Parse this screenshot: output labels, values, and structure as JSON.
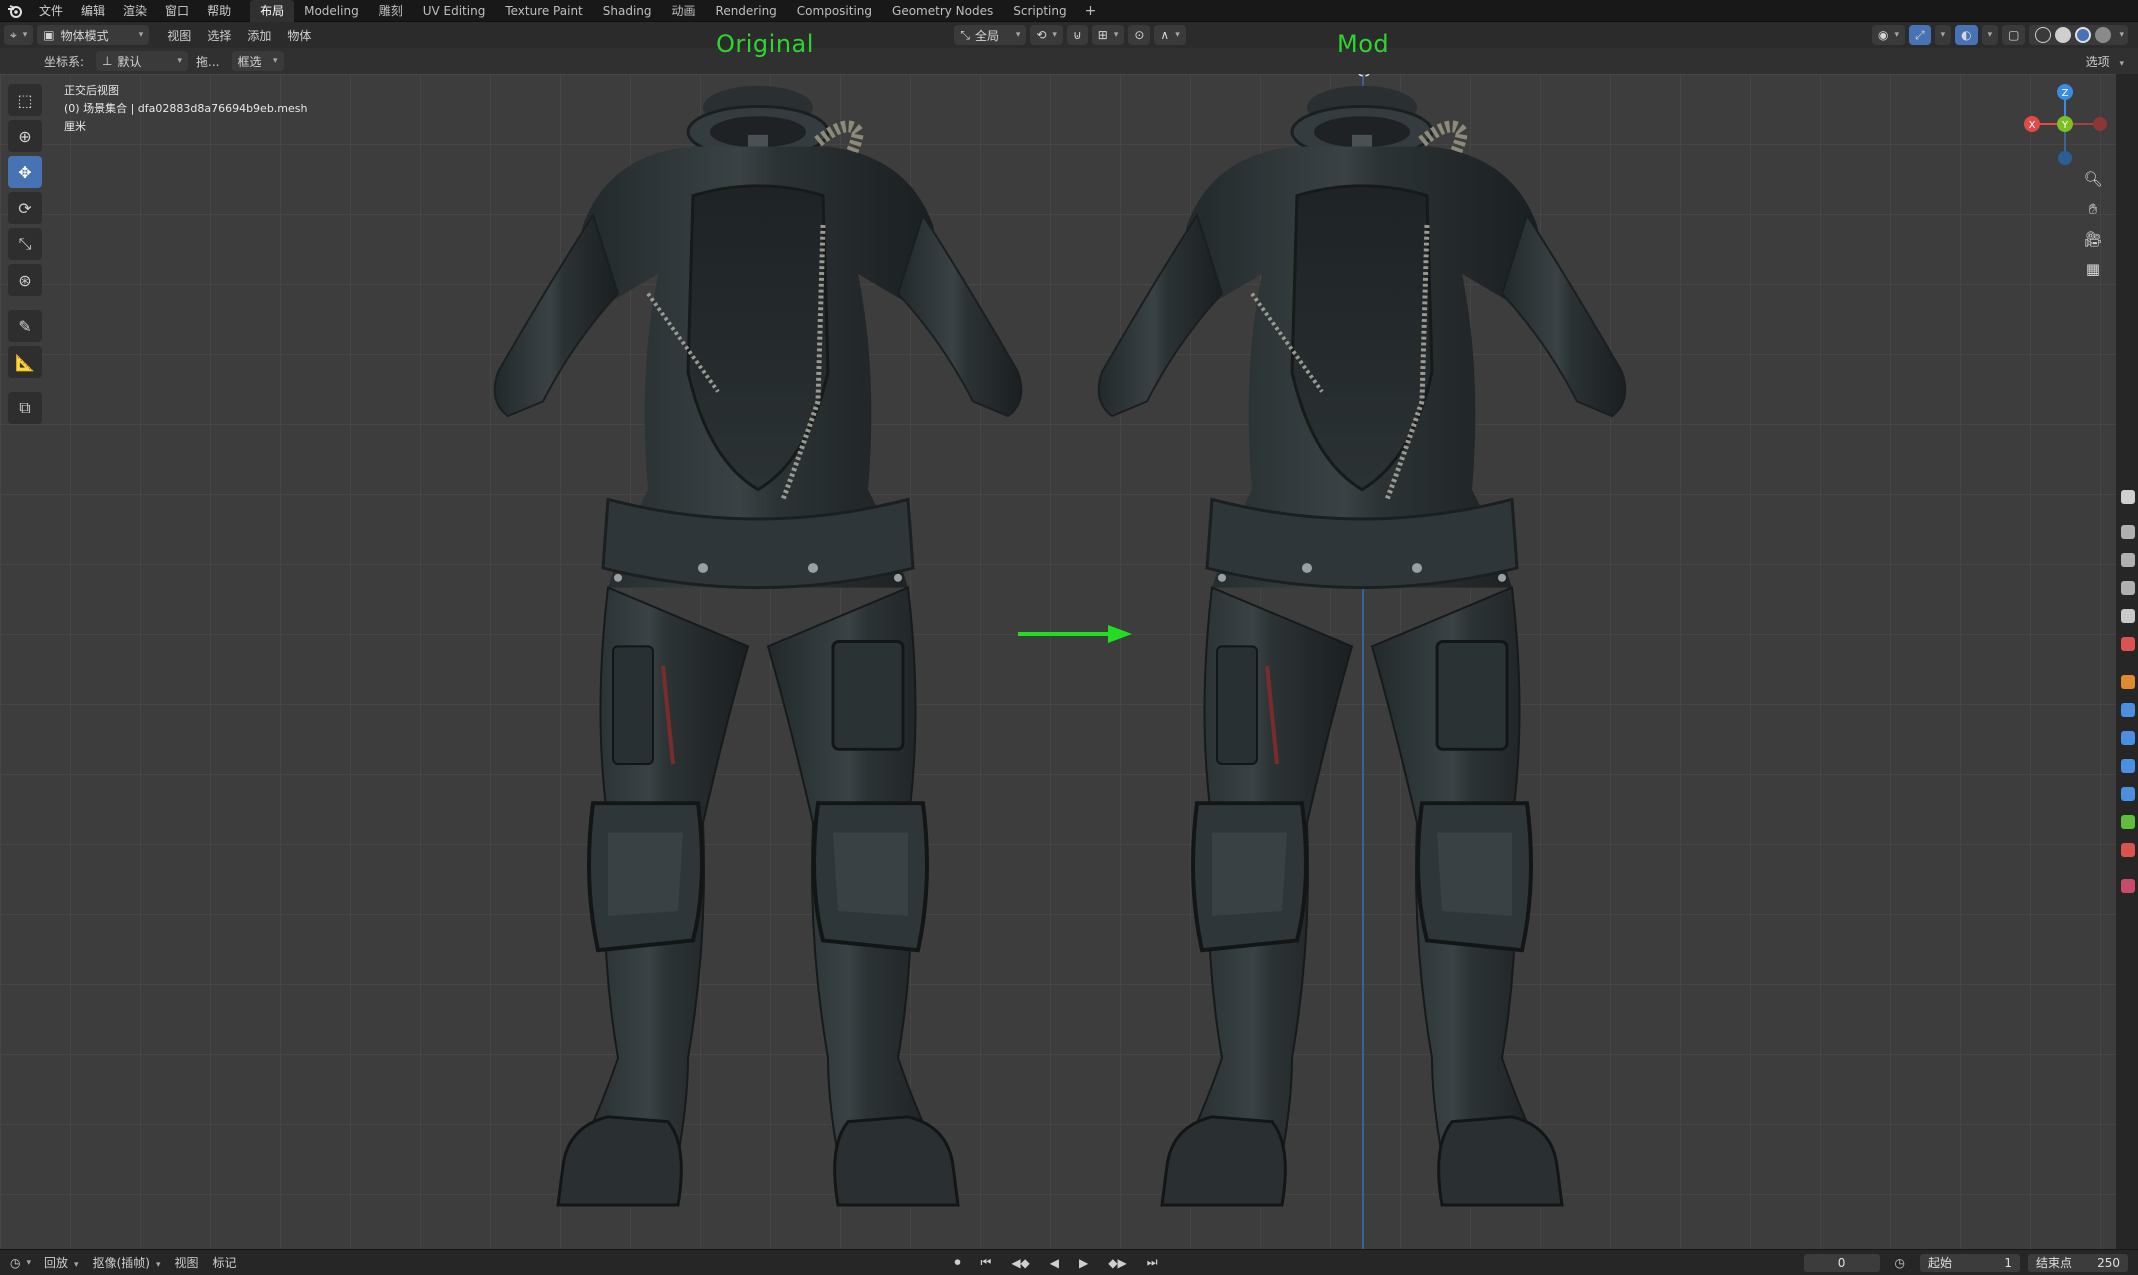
{
  "menubar": {
    "items": [
      "文件",
      "编辑",
      "渲染",
      "窗口",
      "帮助"
    ],
    "workspaces": [
      "布局",
      "Modeling",
      "雕刻",
      "UV Editing",
      "Texture Paint",
      "Shading",
      "动画",
      "Rendering",
      "Compositing",
      "Geometry Nodes",
      "Scripting"
    ],
    "active_workspace": "布局",
    "add_label": "+"
  },
  "viewport_header": {
    "mode": "物体模式",
    "menus": [
      "视图",
      "选择",
      "添加",
      "物体"
    ],
    "transform_orientation": "全局"
  },
  "tool_header": {
    "coord_label": "坐标系:",
    "coord_value": "默认",
    "drag_label": "拖...",
    "select_label": "框选",
    "options_label": "选项"
  },
  "overlay_info": {
    "view_name": "正交后视图",
    "collection": "(0) 场景集合 | dfa02883d8a76694b9eb.mesh",
    "units": "厘米"
  },
  "labels": {
    "left": "Original",
    "right": "Mod"
  },
  "gizmo": {
    "x": "X",
    "y": "Y",
    "z": "Z"
  },
  "timeline": {
    "playback": "回放",
    "keying": "抠像(插帧)",
    "view": "视图",
    "marker": "标记",
    "current_frame": "0",
    "start_label": "起始",
    "start_value": "1",
    "end_label": "结束点",
    "end_value": "250"
  },
  "colors": {
    "accent": "#4772b3",
    "label_green": "#2fd52f",
    "arrow_green": "#22dd22",
    "axis_x": "#e04a4a",
    "axis_y": "#7bc025",
    "axis_z": "#3b8be0"
  }
}
